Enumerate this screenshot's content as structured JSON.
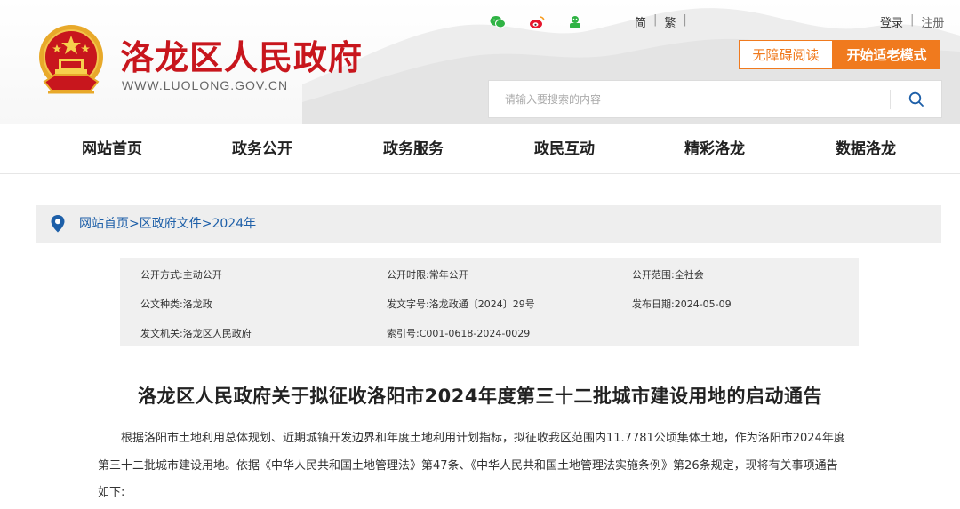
{
  "header": {
    "site_name": "洛龙区人民政府",
    "site_url": "WWW.LUOLONG.GOV.CN",
    "social_icons": [
      "wechat-icon",
      "weibo-icon",
      "mini-program-icon"
    ],
    "lang_simplified": "简",
    "lang_traditional": "繁",
    "login": "登录",
    "register": "注册",
    "accessible_reading": "无障碍阅读",
    "elder_mode": "开始适老模式",
    "search_placeholder": "请输入要搜索的内容",
    "colors": {
      "brand_red": "#c8161d",
      "accent_orange": "#f07a1e",
      "link_blue": "#1d5fa8"
    }
  },
  "nav": {
    "items": [
      "网站首页",
      "政务公开",
      "政务服务",
      "政民互动",
      "精彩洛龙",
      "数据洛龙"
    ]
  },
  "breadcrumb": {
    "items": [
      "网站首页",
      "区政府文件",
      "2024年"
    ],
    "separator": ">"
  },
  "meta": {
    "row1": [
      {
        "label": "公开方式:",
        "value": "主动公开"
      },
      {
        "label": "公开时限:",
        "value": "常年公开"
      },
      {
        "label": "公开范围:",
        "value": "全社会"
      }
    ],
    "row2": [
      {
        "label": "公文种类:",
        "value": "洛龙政"
      },
      {
        "label": "发文字号:",
        "value": "洛龙政通〔2024〕29号"
      },
      {
        "label": "发布日期:",
        "value": "2024-05-09"
      }
    ],
    "row3": [
      {
        "label": "发文机关:",
        "value": "洛龙区人民政府"
      },
      {
        "label": "索引号:",
        "value": "C001-0618-2024-0029"
      }
    ]
  },
  "article": {
    "title": "洛龙区人民政府关于拟征收洛阳市2024年度第三十二批城市建设用地的启动通告",
    "para_line1": "根据洛阳市土地利用总体规划、近期城镇开发边界和年度土地利用计划指标，拟征收我区范围内11.7781公顷集体土地，作为洛阳市2024年度",
    "para_line2": "第三十二批城市建设用地。依据《中华人民共和国土地管理法》第47条、《中华人民共和国土地管理法实施条例》第26条规定，现将有关事项通告",
    "para_line3": "如下:"
  }
}
